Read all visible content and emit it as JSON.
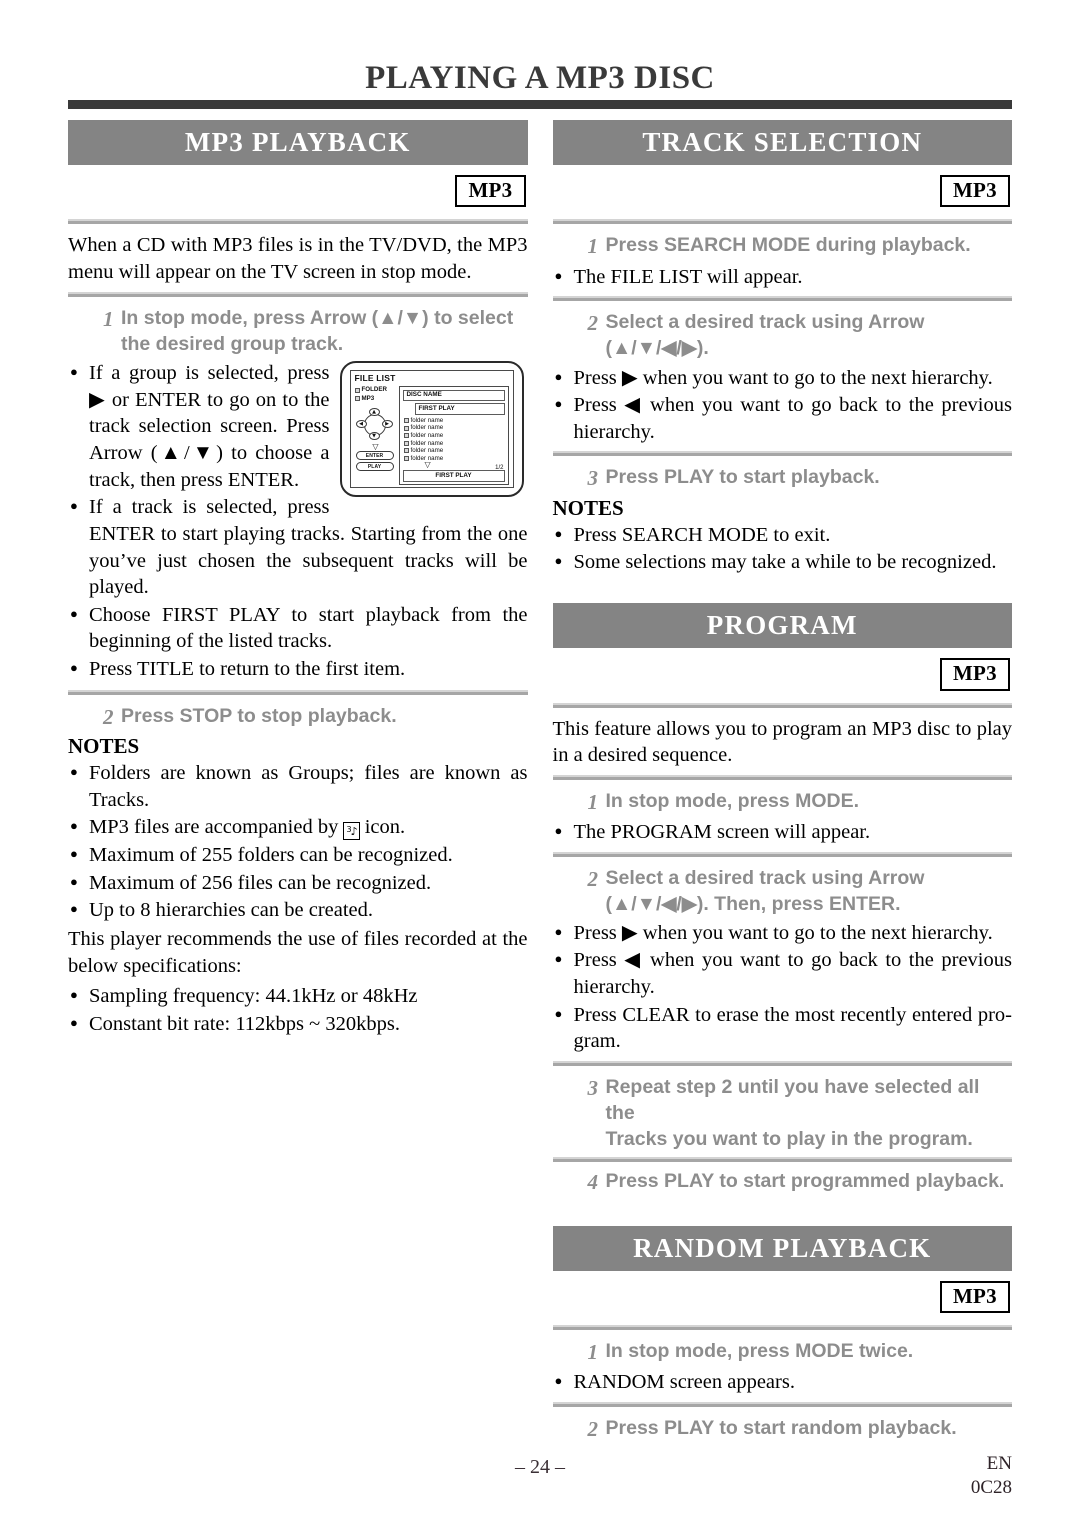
{
  "document": {
    "title": "PLAYING A MP3 DISC",
    "footer": {
      "page_number": "– 24 –",
      "language_code": "EN",
      "doc_code": "0C28"
    }
  },
  "sections": {
    "mp3_playback": {
      "heading": "MP3 PLAYBACK",
      "badge": "MP3",
      "intro": "When a CD with MP3 files is in the TV/DVD, the MP3 menu will appear on the TV screen in stop mode.",
      "step1": {
        "num": "1",
        "text_line1": "In stop mode, press Arrow (▲/▼) to select",
        "text_line2": "the desired group track."
      },
      "bullets": [
        "If a group is selected, press ▶ or ENTER to go on to the track selection screen. Press Arrow (▲/▼) to choose a track, then press ENTER.",
        "If a track is selected, press ENTER to start playing tracks. Starting from the one you’ve just chosen the subsequent tracks will be played.",
        "Choose FIRST PLAY to start playback from the beginning of the listed tracks.",
        "Press TITLE to return to the first item."
      ],
      "step2": {
        "num": "2",
        "text": "Press STOP to stop playback."
      },
      "notes_heading": "NOTES",
      "notes": [
        "Folders are known as Groups; files are known as Tracks.",
        "Maximum of 255 folders can be recognized.",
        "Maximum of 256 files can be recognized.",
        "Up to 8 hierarchies can be created."
      ],
      "note_icon_before": "MP3 files are accompanied by",
      "note_icon_after": "icon.",
      "note_icon_glyph": "3♪",
      "spec_intro": "This player recommends the use of files recorded at the below specifications:",
      "specs": [
        "Sampling frequency: 44.1kHz or 48kHz",
        "Constant bit rate: 112kbps ~ 320kbps."
      ]
    },
    "track_selection": {
      "heading": "TRACK SELECTION",
      "badge": "MP3",
      "step1": {
        "num": "1",
        "text": "Press SEARCH MODE during playback."
      },
      "step1_bullet": "The FILE LIST will appear.",
      "step2": {
        "num": "2",
        "text_line1": "Select a desired track using Arrow",
        "text_line2": "(▲/▼/◀/▶)."
      },
      "step2_bullets": [
        "Press ▶ when you want to go to the next hierarchy.",
        "Press ◀ when you want to go back to the previous hierarchy."
      ],
      "step3": {
        "num": "3",
        "text": "Press PLAY to start playback."
      },
      "notes_heading": "NOTES",
      "notes": [
        "Press SEARCH MODE to exit.",
        "Some selections may take a while to be recognized."
      ]
    },
    "program": {
      "heading": "PROGRAM",
      "badge": "MP3",
      "intro": "This feature allows you to program an MP3 disc to play in a desired sequence.",
      "step1": {
        "num": "1",
        "text": "In stop mode, press MODE."
      },
      "step1_bullet": "The PROGRAM screen will appear.",
      "step2": {
        "num": "2",
        "text_line1": "Select a desired track using Arrow",
        "text_line2": "(▲/▼/◀/▶). Then, press ENTER."
      },
      "step2_bullets": [
        "Press ▶ when you want to go to the next hierarchy.",
        "Press ◀ when you want to go back to the previous hierarchy.",
        "Press CLEAR to erase the most recently entered pro-gram."
      ],
      "step3": {
        "num": "3",
        "text_line1": "Repeat step 2 until you have selected all the",
        "text_line2": "Tracks you want to play in the program."
      },
      "step4": {
        "num": "4",
        "text": "Press PLAY to start programmed playback."
      }
    },
    "random_playback": {
      "heading": "RANDOM PLAYBACK",
      "badge": "MP3",
      "step1": {
        "num": "1",
        "text": "In stop mode, press MODE twice."
      },
      "step1_bullet": "RANDOM screen appears.",
      "step2": {
        "num": "2",
        "text": "Press PLAY to start random playback."
      }
    }
  },
  "figure_file_list": {
    "screen_title": "FILE LIST",
    "legend": [
      "FOLDER",
      "MP3"
    ],
    "dpad": {
      "up": "▲",
      "down": "▼",
      "left": "◀",
      "right": "▶"
    },
    "buttons": [
      "ENTER",
      "PLAY"
    ],
    "disc_name_bar": "DISC NAME",
    "first_play_top": "FIRST PLAY",
    "entries": [
      "folder name",
      "folder name",
      "folder name",
      "folder name",
      "folder name",
      "folder name"
    ],
    "page_indicator": "1/2",
    "first_play_bottom": "FIRST PLAY",
    "scroll_down_glyph": "▽"
  },
  "colors": {
    "band_gray": "#848484",
    "divider_gray": "#a6a6a6",
    "step_text_gray": "#8d8d8d",
    "title_rule": "#3a3a3a"
  }
}
